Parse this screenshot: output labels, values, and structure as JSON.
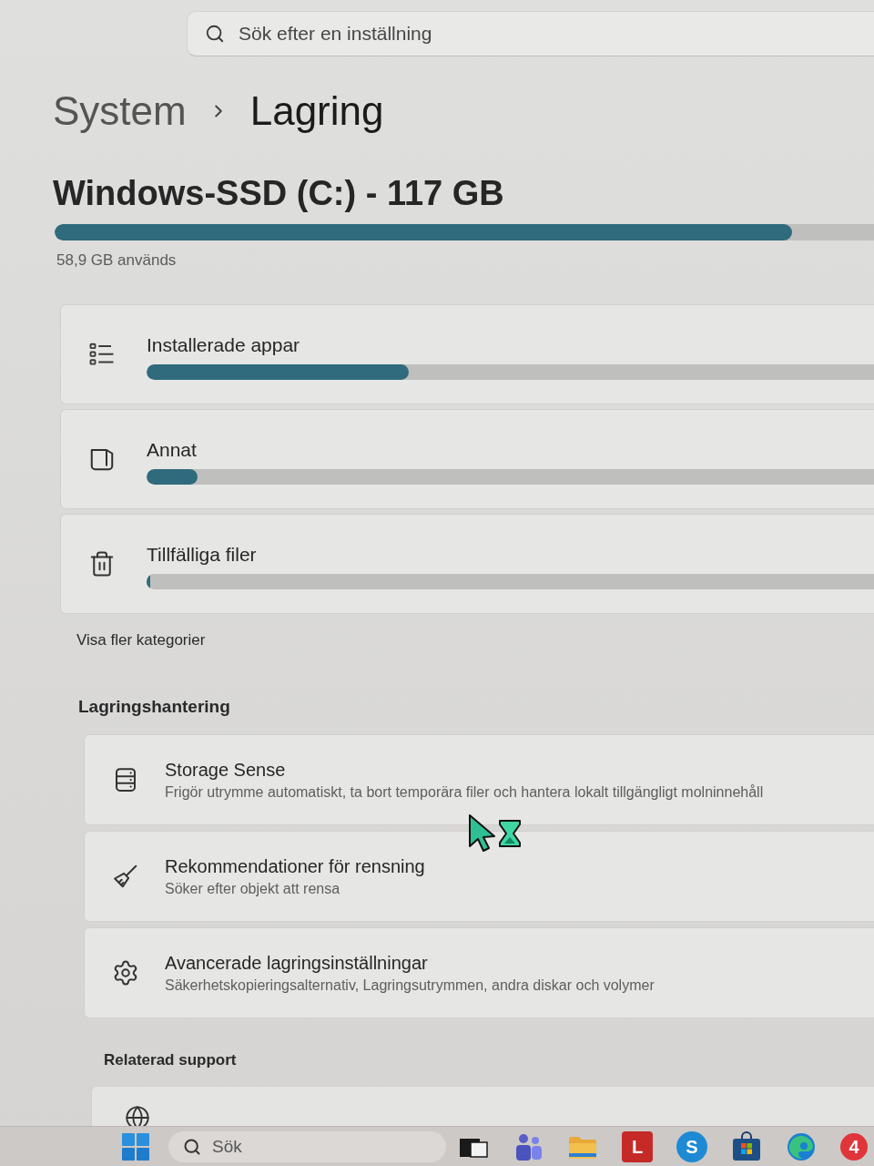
{
  "search": {
    "placeholder": "Sök efter en inställning"
  },
  "breadcrumb": [
    {
      "label": "System",
      "current": false
    },
    {
      "label": "Lagring",
      "current": true
    }
  ],
  "drive": {
    "title": "Windows-SSD (C:) - 117 GB",
    "level": 0.9,
    "usage": "58,9 GB används"
  },
  "categories": [
    {
      "kind": "apps",
      "label": "Installerade appar",
      "level": 0.36
    },
    {
      "kind": "other",
      "label": "Annat",
      "level": 0.07
    },
    {
      "kind": "temp",
      "label": "Tillfälliga filer",
      "level": 0.005
    }
  ],
  "more_link": "Visa fler kategorier",
  "storage_management": {
    "heading": "Lagringshantering",
    "items": [
      {
        "kind": "sense",
        "title": "Storage Sense",
        "description": "Frigör utrymme automatiskt, ta bort temporära filer och hantera lokalt tillgängligt molninnehåll"
      },
      {
        "kind": "cleanup",
        "title": "Rekommendationer för rensning",
        "description": "Söker efter objekt att rensa"
      },
      {
        "kind": "advanced",
        "title": "Avancerade lagringsinställningar",
        "description": "Säkerhetskopieringsalternativ, Lagringsutrymmen, andra diskar och volymer"
      }
    ]
  },
  "related_support": {
    "heading": "Relaterad support",
    "items": [
      {
        "kind": "web"
      }
    ]
  },
  "taskbar": {
    "search_placeholder": "Sök",
    "apps": [
      {
        "kind": "taskview"
      },
      {
        "kind": "teams"
      },
      {
        "kind": "explorer"
      },
      {
        "kind": "tile",
        "glyph": "L"
      },
      {
        "kind": "skype",
        "glyph": "S"
      },
      {
        "kind": "store"
      },
      {
        "kind": "edge"
      },
      {
        "kind": "badge",
        "glyph": "4"
      }
    ]
  }
}
